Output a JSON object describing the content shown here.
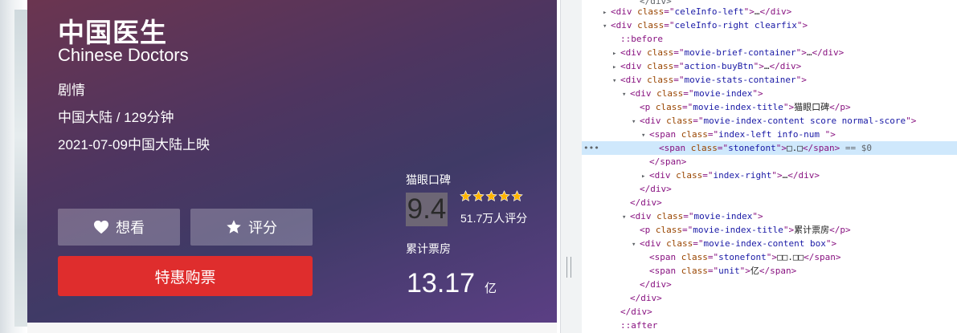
{
  "movie": {
    "title": "中国医生",
    "english_title": "Chinese Doctors",
    "genre": "剧情",
    "meta": "中国大陆 / 129分钟",
    "release": "2021-07-09中国大陆上映"
  },
  "actions": {
    "want_label": "想看",
    "rate_label": "评分",
    "buy_label": "特惠购票"
  },
  "stats": {
    "rating_title": "猫眼口碑",
    "score": "9.4",
    "rating_count": "51.7万人评分",
    "stars_filled": 5,
    "box_title": "累计票房",
    "box_value": "13.17",
    "box_unit": "亿"
  },
  "devtools": {
    "selected_suffix": "== $0",
    "rows": [
      {
        "indent": 4,
        "tri": "▸",
        "tag": "div",
        "cls": "celeInfo-left",
        "rest": "…</div>"
      },
      {
        "indent": 4,
        "tri": "▾",
        "tag": "div",
        "cls": "celeInfo-right clearfix",
        "rest": ""
      },
      {
        "indent": 5,
        "tri": "",
        "pseudo": "::before"
      },
      {
        "indent": 5,
        "tri": "▸",
        "tag": "div",
        "cls": "movie-brief-container",
        "rest": "…</div>"
      },
      {
        "indent": 5,
        "tri": "▸",
        "tag": "div",
        "cls": "action-buyBtn",
        "rest": "…</div>"
      },
      {
        "indent": 5,
        "tri": "▾",
        "tag": "div",
        "cls": "movie-stats-container",
        "rest": ""
      },
      {
        "indent": 6,
        "tri": "▾",
        "tag": "div",
        "cls": "movie-index",
        "rest": ""
      },
      {
        "indent": 7,
        "tri": "",
        "tag": "p",
        "cls": "movie-index-title",
        "text": "猫眼口碑",
        "close": "p"
      },
      {
        "indent": 7,
        "tri": "▾",
        "tag": "div",
        "cls": "movie-index-content score normal-score",
        "rest": ""
      },
      {
        "indent": 8,
        "tri": "▾",
        "tag": "span",
        "cls": "index-left info-num ",
        "rest": ""
      },
      {
        "indent": 9,
        "tri": "",
        "tag": "span",
        "cls": "stonefont",
        "text": "□.□",
        "close": "span",
        "selected": true
      },
      {
        "indent": 8,
        "tri": "",
        "endtag": "span"
      },
      {
        "indent": 8,
        "tri": "▸",
        "tag": "div",
        "cls": "index-right",
        "rest": "…</div>"
      },
      {
        "indent": 7,
        "tri": "",
        "endtag": "div"
      },
      {
        "indent": 6,
        "tri": "",
        "endtag": "div"
      },
      {
        "indent": 6,
        "tri": "▾",
        "tag": "div",
        "cls": "movie-index",
        "rest": ""
      },
      {
        "indent": 7,
        "tri": "",
        "tag": "p",
        "cls": "movie-index-title",
        "text": "累计票房",
        "close": "p"
      },
      {
        "indent": 7,
        "tri": "▾",
        "tag": "div",
        "cls": "movie-index-content box",
        "rest": ""
      },
      {
        "indent": 8,
        "tri": "",
        "tag": "span",
        "cls": "stonefont",
        "text": "□□.□□",
        "close": "span"
      },
      {
        "indent": 8,
        "tri": "",
        "tag": "span",
        "cls": "unit",
        "text": "亿",
        "close": "span"
      },
      {
        "indent": 7,
        "tri": "",
        "endtag": "div"
      },
      {
        "indent": 6,
        "tri": "",
        "endtag": "div"
      },
      {
        "indent": 5,
        "tri": "",
        "endtag": "div"
      },
      {
        "indent": 5,
        "tri": "",
        "pseudo": "::after"
      }
    ]
  }
}
